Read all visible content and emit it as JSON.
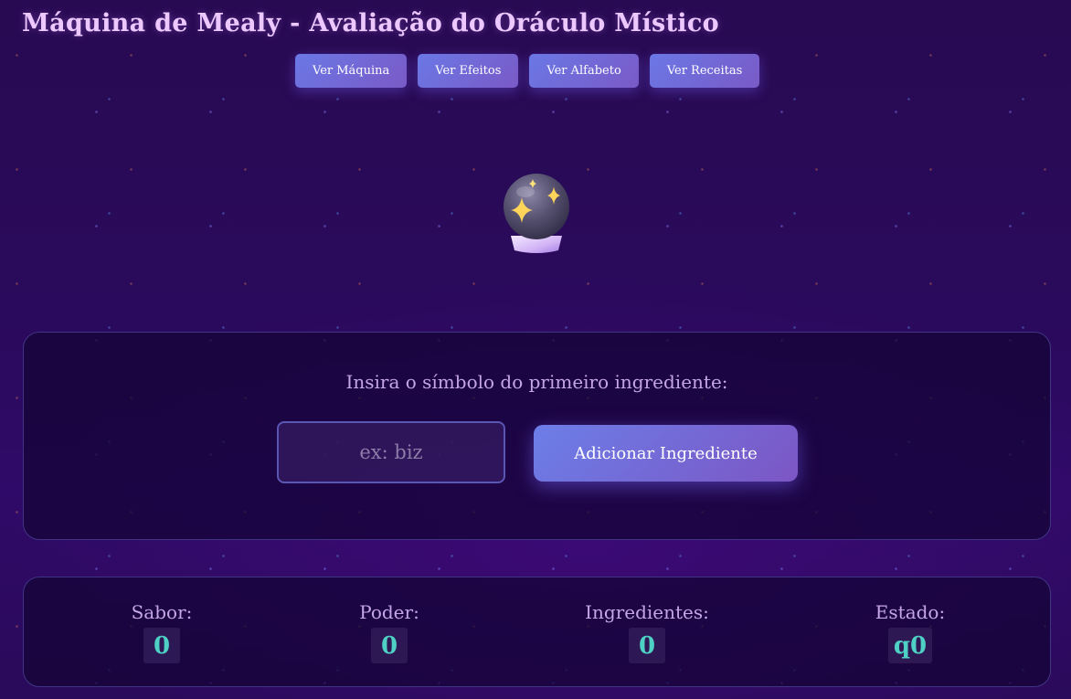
{
  "page": {
    "title": "Máquina de Mealy - Avaliação do Oráculo Místico"
  },
  "nav": {
    "buttons": [
      {
        "label": "Ver Máquina"
      },
      {
        "label": "Ver Efeitos"
      },
      {
        "label": "Ver Alfabeto"
      },
      {
        "label": "Ver Receitas"
      }
    ]
  },
  "oracle": {
    "icon": "crystal-ball-icon"
  },
  "input_panel": {
    "prompt": "Insira o símbolo do primeiro ingrediente:",
    "input_value": "",
    "input_placeholder": "ex: biz",
    "add_button_label": "Adicionar Ingrediente"
  },
  "stats": {
    "sabor": {
      "label": "Sabor:",
      "value": "0"
    },
    "poder": {
      "label": "Poder:",
      "value": "0"
    },
    "ingredientes": {
      "label": "Ingredientes:",
      "value": "0"
    },
    "estado": {
      "label": "Estado:",
      "value": "q0"
    }
  },
  "colors": {
    "background": "#2a0a5c",
    "accent": "#6a78e6",
    "accent_secondary": "#7a5ac6",
    "value_text": "#4fd0c4",
    "title_text": "#ecc8ff"
  }
}
